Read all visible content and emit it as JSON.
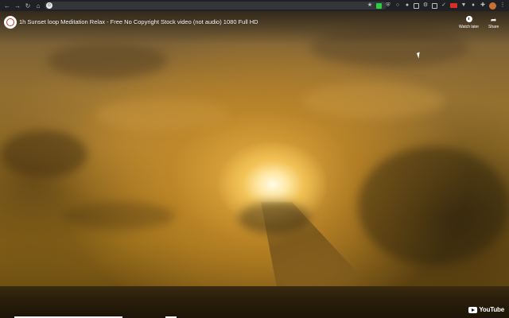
{
  "browser": {
    "icons": {
      "back": "arrow-left-icon",
      "forward": "arrow-right-icon",
      "reload": "reload-icon",
      "home": "home-icon"
    }
  },
  "video": {
    "title": "1h Sunset loop Meditation Relax - Free No Copyright Stock video (not audio) 1080 Full HD",
    "watch_later_label": "Watch later",
    "share_label": "Share",
    "logo_text": "YouTube"
  },
  "colors": {
    "toolbar_bg": "#202124",
    "youtube_red": "#ff0000"
  }
}
